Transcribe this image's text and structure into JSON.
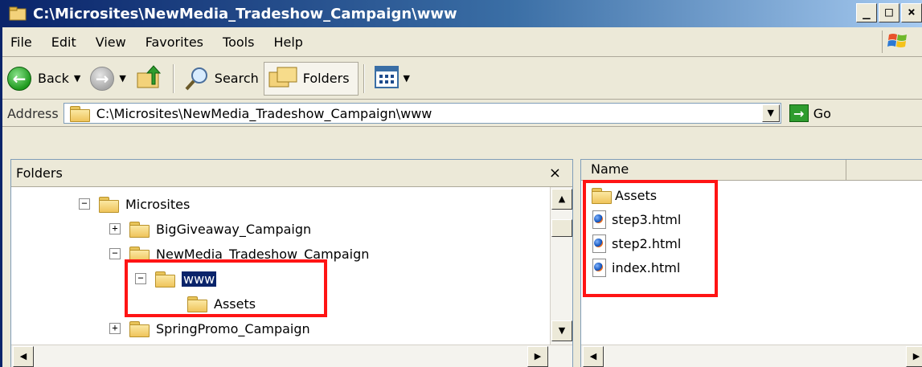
{
  "window": {
    "title": "C:\\Microsites\\NewMedia_Tradeshow_Campaign\\www",
    "caption_buttons": [
      "_",
      "□",
      "×"
    ]
  },
  "menu": [
    "File",
    "Edit",
    "View",
    "Favorites",
    "Tools",
    "Help"
  ],
  "toolbar": {
    "back_label": "Back",
    "search_label": "Search",
    "folders_label": "Folders"
  },
  "address": {
    "label": "Address",
    "value": "C:\\Microsites\\NewMedia_Tradeshow_Campaign\\www",
    "go_label": "Go"
  },
  "folders_pane": {
    "title": "Folders",
    "close_glyph": "×",
    "tree": [
      {
        "label": "Microsites",
        "expander": "−"
      },
      {
        "label": "BigGiveaway_Campaign",
        "expander": "+"
      },
      {
        "label": "NewMedia_Tradeshow_Campaign",
        "expander": "−"
      },
      {
        "label": "www",
        "expander": "−",
        "selected": true
      },
      {
        "label": "Assets",
        "expander": ""
      },
      {
        "label": "SpringPromo_Campaign",
        "expander": "+"
      }
    ]
  },
  "files_pane": {
    "column_name": "Name",
    "files": [
      {
        "name": "Assets",
        "icon": "folder-icon"
      },
      {
        "name": "step3.html",
        "icon": "html-file-icon"
      },
      {
        "name": "step2.html",
        "icon": "html-file-icon"
      },
      {
        "name": "index.html",
        "icon": "html-file-icon"
      }
    ]
  },
  "colors": {
    "highlight": "#ff1414",
    "selection": "#0a246a",
    "titlebar_start": "#0a246a"
  }
}
